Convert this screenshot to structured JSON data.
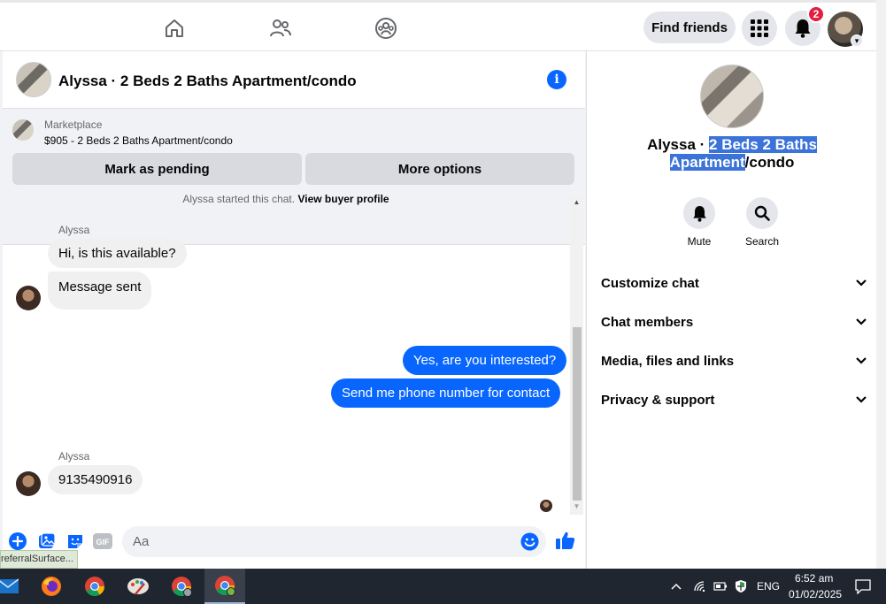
{
  "topbar": {
    "find_friends": "Find friends",
    "notification_count": "2"
  },
  "chat": {
    "title": "Alyssa · 2 Beds 2 Baths Apartment/condo",
    "marketplace": {
      "label": "Marketplace",
      "listing": "$905 - 2 Beds 2 Baths Apartment/condo",
      "mark_pending": "Mark as pending",
      "more_options": "More options"
    },
    "started_text": "Alyssa started this chat.",
    "view_buyer": "View buyer profile",
    "messages": [
      {
        "sender": "Alyssa",
        "text": "Hi, is this available?",
        "direction": "in"
      },
      {
        "text": "Message sent",
        "direction": "in"
      },
      {
        "text": "Yes, are you interested?",
        "direction": "out"
      },
      {
        "text": "Send me phone number for contact",
        "direction": "out"
      },
      {
        "sender": "Alyssa",
        "text": "9135490916",
        "direction": "in"
      }
    ],
    "composer_placeholder": "Aa"
  },
  "status_tip": "referralSurface...",
  "details": {
    "title_plain_start": "Alyssa · ",
    "title_selected_1": "2 Beds 2 Baths",
    "title_selected_2": "Apartment",
    "title_plain_end": "/condo",
    "actions": [
      {
        "label": "Mute",
        "icon": "bell-icon"
      },
      {
        "label": "Search",
        "icon": "search-icon"
      }
    ],
    "sections": [
      "Customize chat",
      "Chat members",
      "Media, files and links",
      "Privacy & support"
    ]
  },
  "taskbar": {
    "language": "ENG",
    "time": "6:52 am",
    "date": "01/02/2025"
  },
  "colors": {
    "accent": "#0866ff",
    "badge": "#e41e3f",
    "selection": "#3b73d8"
  }
}
